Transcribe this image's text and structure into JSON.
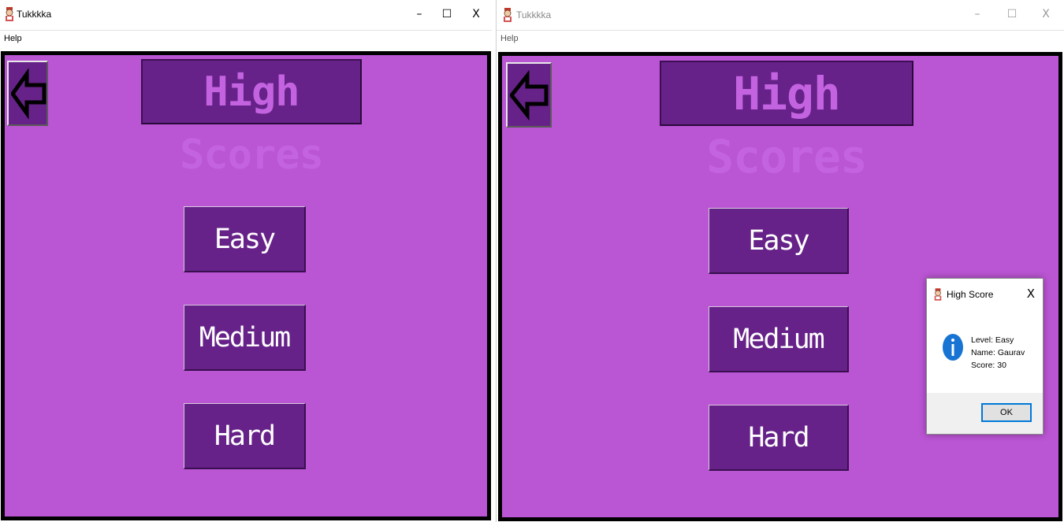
{
  "left_window": {
    "title": "Tukkkka",
    "menu": [
      "Help"
    ],
    "screen_title": "High Scores",
    "buttons": [
      "Easy",
      "Medium",
      "Hard"
    ]
  },
  "right_window": {
    "title": "Tukkkka",
    "menu": [
      "Help"
    ],
    "screen_title": "High Scores",
    "buttons": [
      "Easy",
      "Medium",
      "Hard"
    ]
  },
  "window_controls": {
    "minimize": "–",
    "maximize": "☐",
    "close": "X"
  },
  "dialog": {
    "title": "High Score",
    "close": "X",
    "lines": [
      "Level: Easy",
      "Name: Gaurav",
      "Score: 30"
    ],
    "ok_label": "OK"
  },
  "icons": {
    "app": "character-icon",
    "back": "left-arrow-icon",
    "info": "information-icon"
  },
  "colors": {
    "background": "#ba55d3",
    "button": "#662288",
    "title_text": "#c463e0",
    "button_text": "#ffffff",
    "info_icon": "#1874d2"
  }
}
